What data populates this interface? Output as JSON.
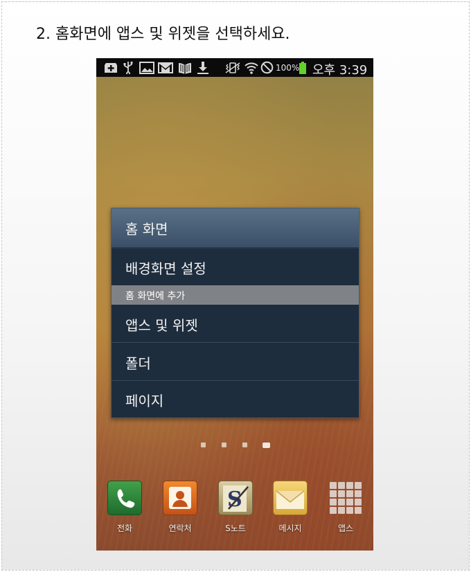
{
  "instruction": "2. 홈화면에 앱스 및 위젯을 선택하세요.",
  "status_bar": {
    "icons": [
      "plus-box-icon",
      "usb-icon",
      "gallery-icon",
      "gmail-icon",
      "book-icon",
      "download-icon",
      "vibrate-icon",
      "wifi-icon",
      "no-signal-icon"
    ],
    "battery_percent": "100%",
    "battery_color": "#62d12a",
    "clock": "오후 3:39"
  },
  "dialog": {
    "title": "홈 화면",
    "items": [
      "배경화면 설정",
      "앱스 및 위젯",
      "폴더",
      "페이지"
    ],
    "section_header": "홈 화면에 추가"
  },
  "page_indicator": {
    "count": 4,
    "active_index": 3
  },
  "dock": {
    "items": [
      {
        "label": "전화",
        "icon": "phone-icon"
      },
      {
        "label": "연락처",
        "icon": "contacts-icon"
      },
      {
        "label": "S노트",
        "icon": "s-note-icon"
      },
      {
        "label": "메시지",
        "icon": "message-icon"
      },
      {
        "label": "앱스",
        "icon": "apps-grid-icon"
      }
    ]
  },
  "colors": {
    "dialog_background": "#1e2d3d",
    "dialog_title": "#4a6079",
    "section_header": "#7f8387"
  }
}
